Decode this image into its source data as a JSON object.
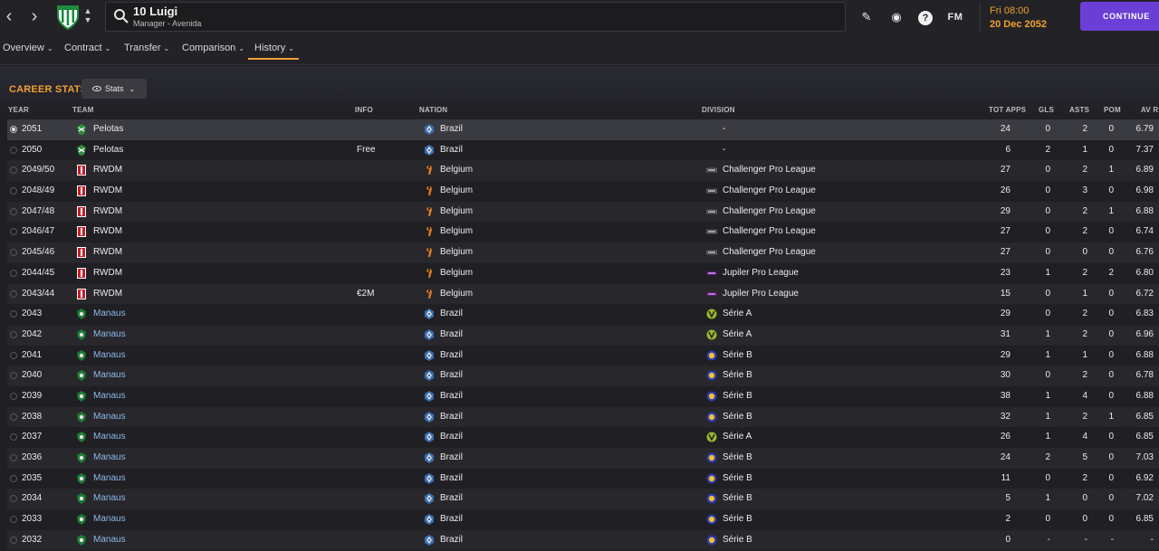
{
  "header": {
    "back_icon": "chevron-left-icon",
    "forward_icon": "chevron-right-icon",
    "profile_name": "10 Luigi",
    "profile_sub": "Manager - Avenida",
    "date_time": "Fri 08:00",
    "date_day": "20 Dec 2052",
    "continue_label": "CONTINUE",
    "fm_label": "FM"
  },
  "tabs": [
    {
      "label": "Overview"
    },
    {
      "label": "Contract"
    },
    {
      "label": "Transfer"
    },
    {
      "label": "Comparison"
    },
    {
      "label": "History"
    }
  ],
  "section": {
    "title": "CAREER STATS",
    "stats_button": "Stats"
  },
  "columns": {
    "year": "YEAR",
    "team": "TEAM",
    "info": "INFO",
    "nation": "NATION",
    "division": "DIVISION",
    "apps": "TOT APPS",
    "gls": "GLS",
    "asts": "ASTS",
    "pom": "POM",
    "avr": "AV R"
  },
  "colors": {
    "accent": "#f0a030",
    "continue": "#6b3fd6",
    "link": "#8fb8e8"
  },
  "rows": [
    {
      "year": "2051",
      "team": "Pelotas",
      "info": "",
      "nation": "Brazil",
      "division": "-",
      "apps": "24",
      "gls": "0",
      "asts": "2",
      "pom": "0",
      "avr": "6.79"
    },
    {
      "year": "2050",
      "team": "Pelotas",
      "info": "Free",
      "nation": "Brazil",
      "division": "-",
      "apps": "6",
      "gls": "2",
      "asts": "1",
      "pom": "0",
      "avr": "7.37"
    },
    {
      "year": "2049/50",
      "team": "RWDM",
      "info": "",
      "nation": "Belgium",
      "division": "Challenger Pro League",
      "apps": "27",
      "gls": "0",
      "asts": "2",
      "pom": "1",
      "avr": "6.89"
    },
    {
      "year": "2048/49",
      "team": "RWDM",
      "info": "",
      "nation": "Belgium",
      "division": "Challenger Pro League",
      "apps": "26",
      "gls": "0",
      "asts": "3",
      "pom": "0",
      "avr": "6.98"
    },
    {
      "year": "2047/48",
      "team": "RWDM",
      "info": "",
      "nation": "Belgium",
      "division": "Challenger Pro League",
      "apps": "29",
      "gls": "0",
      "asts": "2",
      "pom": "1",
      "avr": "6.88"
    },
    {
      "year": "2046/47",
      "team": "RWDM",
      "info": "",
      "nation": "Belgium",
      "division": "Challenger Pro League",
      "apps": "27",
      "gls": "0",
      "asts": "2",
      "pom": "0",
      "avr": "6.74"
    },
    {
      "year": "2045/46",
      "team": "RWDM",
      "info": "",
      "nation": "Belgium",
      "division": "Challenger Pro League",
      "apps": "27",
      "gls": "0",
      "asts": "0",
      "pom": "0",
      "avr": "6.76"
    },
    {
      "year": "2044/45",
      "team": "RWDM",
      "info": "",
      "nation": "Belgium",
      "division": "Jupiler Pro League",
      "apps": "23",
      "gls": "1",
      "asts": "2",
      "pom": "2",
      "avr": "6.80"
    },
    {
      "year": "2043/44",
      "team": "RWDM",
      "info": "€2M",
      "nation": "Belgium",
      "division": "Jupiler Pro League",
      "apps": "15",
      "gls": "0",
      "asts": "1",
      "pom": "0",
      "avr": "6.72"
    },
    {
      "year": "2043",
      "team": "Manaus",
      "info": "",
      "nation": "Brazil",
      "division": "Série A",
      "apps": "29",
      "gls": "0",
      "asts": "2",
      "pom": "0",
      "avr": "6.83"
    },
    {
      "year": "2042",
      "team": "Manaus",
      "info": "",
      "nation": "Brazil",
      "division": "Série A",
      "apps": "31",
      "gls": "1",
      "asts": "2",
      "pom": "0",
      "avr": "6.96"
    },
    {
      "year": "2041",
      "team": "Manaus",
      "info": "",
      "nation": "Brazil",
      "division": "Série B",
      "apps": "29",
      "gls": "1",
      "asts": "1",
      "pom": "0",
      "avr": "6.88"
    },
    {
      "year": "2040",
      "team": "Manaus",
      "info": "",
      "nation": "Brazil",
      "division": "Série B",
      "apps": "30",
      "gls": "0",
      "asts": "2",
      "pom": "0",
      "avr": "6.78"
    },
    {
      "year": "2039",
      "team": "Manaus",
      "info": "",
      "nation": "Brazil",
      "division": "Série B",
      "apps": "38",
      "gls": "1",
      "asts": "4",
      "pom": "0",
      "avr": "6.88"
    },
    {
      "year": "2038",
      "team": "Manaus",
      "info": "",
      "nation": "Brazil",
      "division": "Série B",
      "apps": "32",
      "gls": "1",
      "asts": "2",
      "pom": "1",
      "avr": "6.85"
    },
    {
      "year": "2037",
      "team": "Manaus",
      "info": "",
      "nation": "Brazil",
      "division": "Série A",
      "apps": "26",
      "gls": "1",
      "asts": "4",
      "pom": "0",
      "avr": "6.85"
    },
    {
      "year": "2036",
      "team": "Manaus",
      "info": "",
      "nation": "Brazil",
      "division": "Série B",
      "apps": "24",
      "gls": "2",
      "asts": "5",
      "pom": "0",
      "avr": "7.03"
    },
    {
      "year": "2035",
      "team": "Manaus",
      "info": "",
      "nation": "Brazil",
      "division": "Série B",
      "apps": "11",
      "gls": "0",
      "asts": "2",
      "pom": "0",
      "avr": "6.92"
    },
    {
      "year": "2034",
      "team": "Manaus",
      "info": "",
      "nation": "Brazil",
      "division": "Série B",
      "apps": "5",
      "gls": "1",
      "asts": "0",
      "pom": "0",
      "avr": "7.02"
    },
    {
      "year": "2033",
      "team": "Manaus",
      "info": "",
      "nation": "Brazil",
      "division": "Série B",
      "apps": "2",
      "gls": "0",
      "asts": "0",
      "pom": "0",
      "avr": "6.85"
    },
    {
      "year": "2032",
      "team": "Manaus",
      "info": "",
      "nation": "Brazil",
      "division": "Série B",
      "apps": "0",
      "gls": "-",
      "asts": "-",
      "pom": "-",
      "avr": "-"
    }
  ]
}
